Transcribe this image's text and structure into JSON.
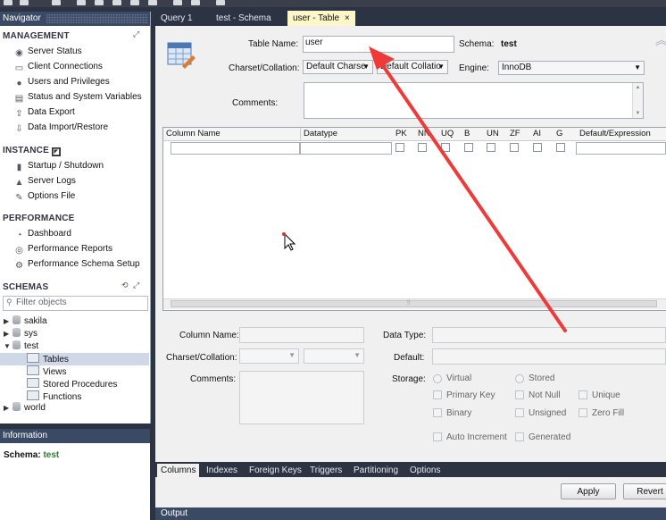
{
  "navigator": {
    "title": "Navigator",
    "management": {
      "title": "MANAGEMENT",
      "items": [
        {
          "label": "Server Status",
          "icon": "server-status-icon"
        },
        {
          "label": "Client Connections",
          "icon": "client-connections-icon"
        },
        {
          "label": "Users and Privileges",
          "icon": "users-icon"
        },
        {
          "label": "Status and System Variables",
          "icon": "variables-icon"
        },
        {
          "label": "Data Export",
          "icon": "export-icon"
        },
        {
          "label": "Data Import/Restore",
          "icon": "import-icon"
        }
      ]
    },
    "instance": {
      "title": "INSTANCE",
      "items": [
        {
          "label": "Startup / Shutdown",
          "icon": "startup-icon"
        },
        {
          "label": "Server Logs",
          "icon": "warning-icon"
        },
        {
          "label": "Options File",
          "icon": "wrench-icon"
        }
      ]
    },
    "performance": {
      "title": "PERFORMANCE",
      "items": [
        {
          "label": "Dashboard",
          "icon": "dashboard-icon"
        },
        {
          "label": "Performance Reports",
          "icon": "reports-icon"
        },
        {
          "label": "Performance Schema Setup",
          "icon": "schema-setup-icon"
        }
      ]
    },
    "schemas": {
      "title": "SCHEMAS",
      "filter_placeholder": "Filter objects",
      "tree": [
        {
          "label": "sakila"
        },
        {
          "label": "sys"
        },
        {
          "label": "test"
        },
        {
          "label": "Tables"
        },
        {
          "label": "Views"
        },
        {
          "label": "Stored Procedures"
        },
        {
          "label": "Functions"
        },
        {
          "label": "world"
        }
      ]
    }
  },
  "info": {
    "title": "Information",
    "schema_label": "Schema:",
    "schema_value": "test"
  },
  "tabs": [
    {
      "label": "Query 1"
    },
    {
      "label": "test - Schema"
    },
    {
      "label": "user - Table",
      "close": "×"
    }
  ],
  "editor": {
    "table_name_label": "Table Name:",
    "table_name_value": "user",
    "schema_label": "Schema:",
    "schema_value": "test",
    "charset_label": "Charset/Collation:",
    "charset_value": "Default Charse",
    "collation_value": "Default Collatio",
    "engine_label": "Engine:",
    "engine_value": "InnoDB",
    "comments_label": "Comments:",
    "columns": [
      "Column Name",
      "Datatype",
      "PK",
      "NN",
      "UQ",
      "B",
      "UN",
      "ZF",
      "AI",
      "G",
      "Default/Expression"
    ],
    "detail": {
      "column_name_label": "Column Name:",
      "charset_label": "Charset/Collation:",
      "comments_label": "Comments:",
      "data_type_label": "Data Type:",
      "default_label": "Default:",
      "storage_label": "Storage:",
      "virtual": "Virtual",
      "stored": "Stored",
      "primary_key": "Primary Key",
      "not_null": "Not Null",
      "unique": "Unique",
      "binary": "Binary",
      "unsigned": "Unsigned",
      "zero_fill": "Zero Fill",
      "auto_increment": "Auto Increment",
      "generated": "Generated"
    }
  },
  "bottom_tabs": [
    "Columns",
    "Indexes",
    "Foreign Keys",
    "Triggers",
    "Partitioning",
    "Options"
  ],
  "buttons": {
    "apply": "Apply",
    "revert": "Revert"
  },
  "output": {
    "title": "Output"
  },
  "colors": {
    "arrow": "#ef3a3a",
    "active_tab": "#fdf6c8",
    "panel_header": "#3b4a64"
  }
}
